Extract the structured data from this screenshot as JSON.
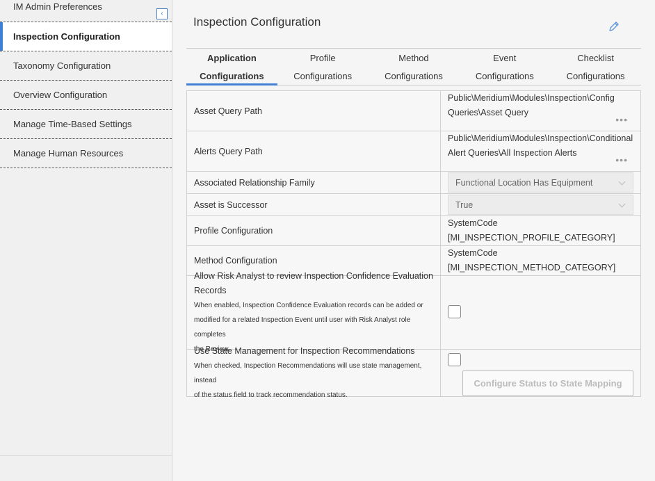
{
  "sidebar": {
    "header_title": "IM Admin Preferences",
    "collapse_icon": "chevron-left-icon",
    "items": [
      {
        "label": "Inspection Configuration",
        "active": true
      },
      {
        "label": "Taxonomy Configuration"
      },
      {
        "label": "Overview Configuration"
      },
      {
        "label": "Manage Time-Based Settings"
      },
      {
        "label": "Manage Human Resources"
      }
    ]
  },
  "main": {
    "title": "Inspection Configuration",
    "edit_icon": "pencil-icon",
    "tabs": [
      {
        "line1": "Application",
        "line2": "Configurations",
        "active": true
      },
      {
        "line1": "Profile",
        "line2": "Configurations"
      },
      {
        "line1": "Method",
        "line2": "Configurations"
      },
      {
        "line1": "Event",
        "line2": "Configurations"
      },
      {
        "line1": "Checklist",
        "line2": "Configurations"
      }
    ],
    "rows": {
      "asset_query": {
        "label": "Asset Query Path",
        "line1": "Public\\Meridium\\Modules\\Inspection\\Config",
        "line2": "Queries\\Asset Query",
        "more": "•••"
      },
      "alerts_query": {
        "label": "Alerts Query Path",
        "line1": "Public\\Meridium\\Modules\\Inspection\\Conditional",
        "line2": "Alert Queries\\All Inspection Alerts",
        "more": "•••"
      },
      "relationship": {
        "label": "Associated Relationship Family",
        "value": "Functional Location Has Equipment"
      },
      "successor": {
        "label": "Asset is Successor",
        "value": "True"
      },
      "profile_cfg": {
        "label": "Profile Configuration",
        "line1": "SystemCode",
        "line2": "[MI_INSPECTION_PROFILE_CATEGORY]"
      },
      "method_cfg": {
        "label": "Method Configuration",
        "line1": "SystemCode",
        "line2": "[MI_INSPECTION_METHOD_CATEGORY]"
      },
      "risk_analyst": {
        "label_line1": "Allow Risk Analyst to review Inspection Confidence Evaluation",
        "label_line2": "Records",
        "help_line1": "When enabled, Inspection Confidence Evaluation records can be added or",
        "help_line2": "modified for a related Inspection Event until user with Risk Analyst role completes",
        "help_line3": "the Review.",
        "checked": false
      },
      "state_mgmt": {
        "label": "Use State Management for Inspection Recommendations",
        "help_line1": "When checked, Inspection Recommendations will use state management, instead",
        "help_line2": "of the status field to track recommendation status.",
        "checked": false,
        "button_label": "Configure Status to State Mapping"
      }
    }
  },
  "colors": {
    "accent": "#3f7fd6",
    "sidebar_bg": "#f0f0f0",
    "main_bg": "#f5f5f5"
  }
}
